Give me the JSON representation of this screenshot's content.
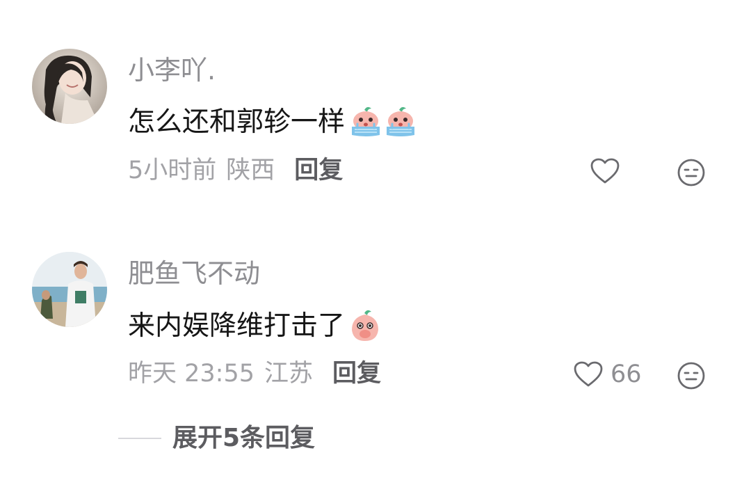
{
  "comments": [
    {
      "username": "小李吖.",
      "text": "怎么还和郭轸一样",
      "emojis": [
        "crying-peach-emoji",
        "crying-peach-emoji"
      ],
      "time": "5小时前",
      "location": "陕西",
      "reply_label": "回复",
      "likes": "",
      "icons": {
        "like": "heart-outline-icon",
        "dislike": "neutral-face-icon"
      }
    },
    {
      "username": "肥鱼飞不动",
      "text": "来内娱降维打击了",
      "emojis": [
        "covering-mouth-peach-emoji"
      ],
      "time": "昨天 23:55",
      "location": "江苏",
      "reply_label": "回复",
      "likes": "66",
      "icons": {
        "like": "heart-outline-icon",
        "dislike": "neutral-face-icon"
      }
    }
  ],
  "expand_replies": {
    "label": "展开5条回复"
  },
  "colors": {
    "username": "#8e8e92",
    "content": "#161616",
    "meta": "#a2a2a6",
    "reply": "#5c5c60",
    "icon": "#6a6a6e",
    "emoji_peach": "#f6b5ad",
    "emoji_tear": "#7fc3ea",
    "emoji_leaf": "#52b788"
  }
}
